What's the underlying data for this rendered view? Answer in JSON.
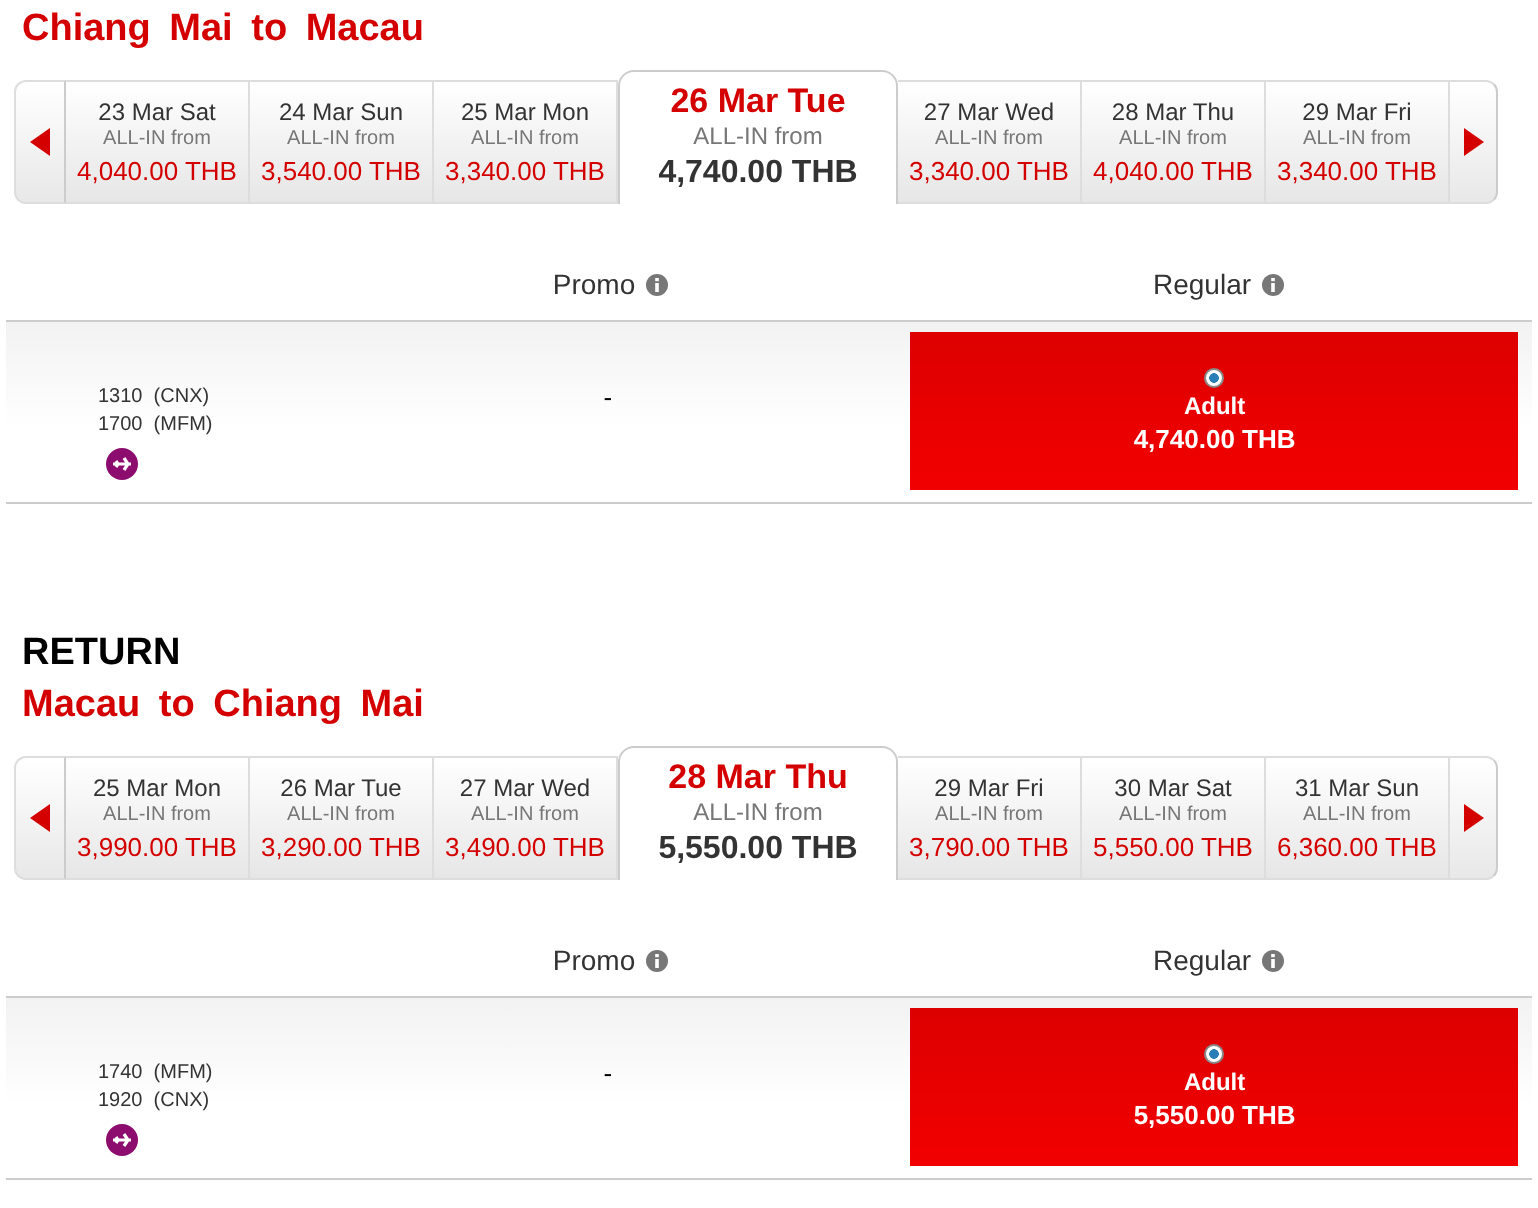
{
  "sections": [
    {
      "title": "Chiang Mai to Macau",
      "dates": [
        {
          "label": "23 Mar Sat",
          "caption": "ALL-IN from",
          "price": "4,040.00 THB",
          "selected": false
        },
        {
          "label": "24 Mar Sun",
          "caption": "ALL-IN from",
          "price": "3,540.00 THB",
          "selected": false
        },
        {
          "label": "25 Mar Mon",
          "caption": "ALL-IN from",
          "price": "3,340.00 THB",
          "selected": false
        },
        {
          "label": "26 Mar Tue",
          "caption": "ALL-IN from",
          "price": "4,740.00 THB",
          "selected": true
        },
        {
          "label": "27 Mar Wed",
          "caption": "ALL-IN from",
          "price": "3,340.00 THB",
          "selected": false
        },
        {
          "label": "28 Mar Thu",
          "caption": "ALL-IN from",
          "price": "4,040.00 THB",
          "selected": false
        },
        {
          "label": "29 Mar Fri",
          "caption": "ALL-IN from",
          "price": "3,340.00 THB",
          "selected": false
        }
      ],
      "columns": [
        "Promo",
        "Regular"
      ],
      "flight": {
        "departure": {
          "time": "1310",
          "airport": "(CNX)"
        },
        "arrival": {
          "time": "1700",
          "airport": "(MFM)"
        },
        "promo": "-",
        "regular": {
          "passenger": "Adult",
          "price": "4,740.00 THB",
          "selected": true
        }
      }
    },
    {
      "label": "RETURN",
      "title": "Macau to Chiang Mai",
      "dates": [
        {
          "label": "25 Mar Mon",
          "caption": "ALL-IN from",
          "price": "3,990.00 THB",
          "selected": false
        },
        {
          "label": "26 Mar Tue",
          "caption": "ALL-IN from",
          "price": "3,290.00 THB",
          "selected": false
        },
        {
          "label": "27 Mar Wed",
          "caption": "ALL-IN from",
          "price": "3,490.00 THB",
          "selected": false
        },
        {
          "label": "28 Mar Thu",
          "caption": "ALL-IN from",
          "price": "5,550.00 THB",
          "selected": true
        },
        {
          "label": "29 Mar Fri",
          "caption": "ALL-IN from",
          "price": "3,790.00 THB",
          "selected": false
        },
        {
          "label": "30 Mar Sat",
          "caption": "ALL-IN from",
          "price": "5,550.00 THB",
          "selected": false
        },
        {
          "label": "31 Mar Sun",
          "caption": "ALL-IN from",
          "price": "6,360.00 THB",
          "selected": false
        }
      ],
      "columns": [
        "Promo",
        "Regular"
      ],
      "flight": {
        "departure": {
          "time": "1740",
          "airport": "(MFM)"
        },
        "arrival": {
          "time": "1920",
          "airport": "(CNX)"
        },
        "promo": "-",
        "regular": {
          "passenger": "Adult",
          "price": "5,550.00 THB",
          "selected": true
        }
      }
    }
  ]
}
